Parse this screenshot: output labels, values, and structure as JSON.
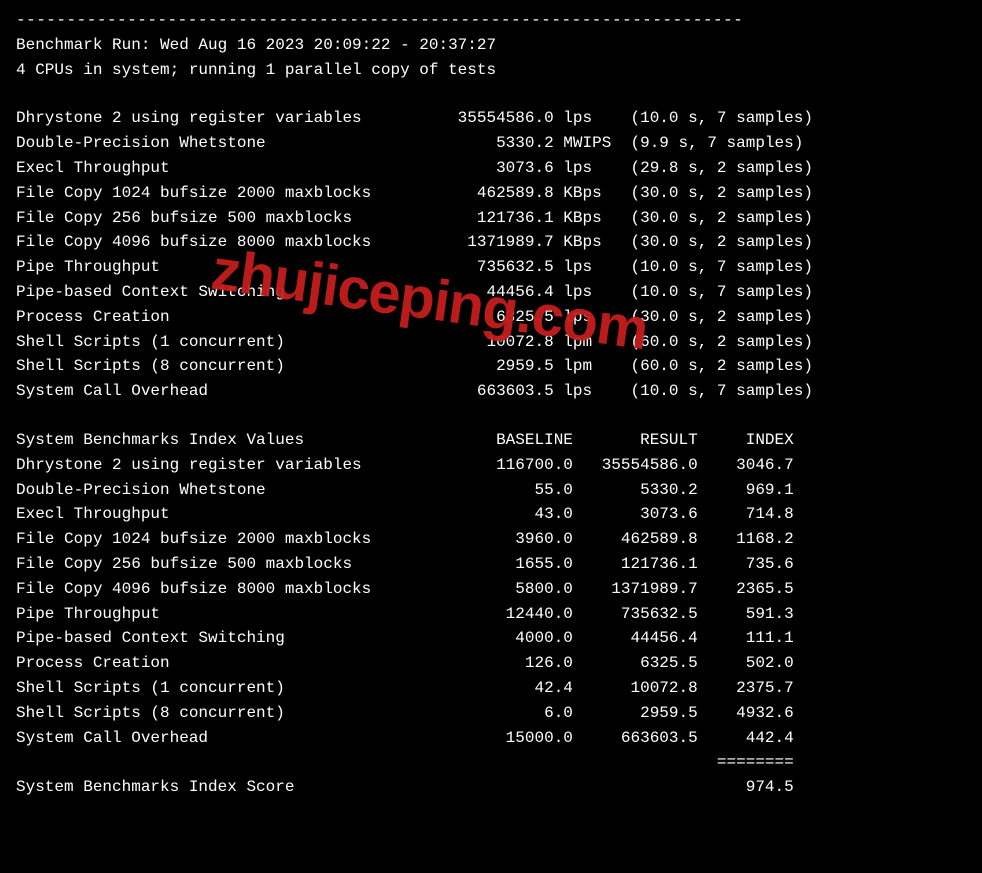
{
  "separator": "------------------------------------------------------------------------",
  "header": {
    "run_line": "Benchmark Run: Wed Aug 16 2023 20:09:22 - 20:37:27",
    "cpu_line": "4 CPUs in system; running 1 parallel copy of tests"
  },
  "results": [
    {
      "name": "Dhrystone 2 using register variables",
      "value": "35554586.0",
      "unit": "lps",
      "timing": "(10.0 s, 7 samples)"
    },
    {
      "name": "Double-Precision Whetstone",
      "value": "5330.2",
      "unit": "MWIPS",
      "timing": "(9.9 s, 7 samples)"
    },
    {
      "name": "Execl Throughput",
      "value": "3073.6",
      "unit": "lps",
      "timing": "(29.8 s, 2 samples)"
    },
    {
      "name": "File Copy 1024 bufsize 2000 maxblocks",
      "value": "462589.8",
      "unit": "KBps",
      "timing": "(30.0 s, 2 samples)"
    },
    {
      "name": "File Copy 256 bufsize 500 maxblocks",
      "value": "121736.1",
      "unit": "KBps",
      "timing": "(30.0 s, 2 samples)"
    },
    {
      "name": "File Copy 4096 bufsize 8000 maxblocks",
      "value": "1371989.7",
      "unit": "KBps",
      "timing": "(30.0 s, 2 samples)"
    },
    {
      "name": "Pipe Throughput",
      "value": "735632.5",
      "unit": "lps",
      "timing": "(10.0 s, 7 samples)"
    },
    {
      "name": "Pipe-based Context Switching",
      "value": "44456.4",
      "unit": "lps",
      "timing": "(10.0 s, 7 samples)"
    },
    {
      "name": "Process Creation",
      "value": "6325.5",
      "unit": "lps",
      "timing": "(30.0 s, 2 samples)"
    },
    {
      "name": "Shell Scripts (1 concurrent)",
      "value": "10072.8",
      "unit": "lpm",
      "timing": "(60.0 s, 2 samples)"
    },
    {
      "name": "Shell Scripts (8 concurrent)",
      "value": "2959.5",
      "unit": "lpm",
      "timing": "(60.0 s, 2 samples)"
    },
    {
      "name": "System Call Overhead",
      "value": "663603.5",
      "unit": "lps",
      "timing": "(10.0 s, 7 samples)"
    }
  ],
  "index_header": {
    "title": "System Benchmarks Index Values",
    "col_baseline": "BASELINE",
    "col_result": "RESULT",
    "col_index": "INDEX"
  },
  "index_rows": [
    {
      "name": "Dhrystone 2 using register variables",
      "baseline": "116700.0",
      "result": "35554586.0",
      "index": "3046.7"
    },
    {
      "name": "Double-Precision Whetstone",
      "baseline": "55.0",
      "result": "5330.2",
      "index": "969.1"
    },
    {
      "name": "Execl Throughput",
      "baseline": "43.0",
      "result": "3073.6",
      "index": "714.8"
    },
    {
      "name": "File Copy 1024 bufsize 2000 maxblocks",
      "baseline": "3960.0",
      "result": "462589.8",
      "index": "1168.2"
    },
    {
      "name": "File Copy 256 bufsize 500 maxblocks",
      "baseline": "1655.0",
      "result": "121736.1",
      "index": "735.6"
    },
    {
      "name": "File Copy 4096 bufsize 8000 maxblocks",
      "baseline": "5800.0",
      "result": "1371989.7",
      "index": "2365.5"
    },
    {
      "name": "Pipe Throughput",
      "baseline": "12440.0",
      "result": "735632.5",
      "index": "591.3"
    },
    {
      "name": "Pipe-based Context Switching",
      "baseline": "4000.0",
      "result": "44456.4",
      "index": "111.1"
    },
    {
      "name": "Process Creation",
      "baseline": "126.0",
      "result": "6325.5",
      "index": "502.0"
    },
    {
      "name": "Shell Scripts (1 concurrent)",
      "baseline": "42.4",
      "result": "10072.8",
      "index": "2375.7"
    },
    {
      "name": "Shell Scripts (8 concurrent)",
      "baseline": "6.0",
      "result": "2959.5",
      "index": "4932.6"
    },
    {
      "name": "System Call Overhead",
      "baseline": "15000.0",
      "result": "663603.5",
      "index": "442.4"
    }
  ],
  "index_sep": "========",
  "score": {
    "label": "System Benchmarks Index Score",
    "value": "974.5"
  },
  "watermark": "zhujiceping.com"
}
